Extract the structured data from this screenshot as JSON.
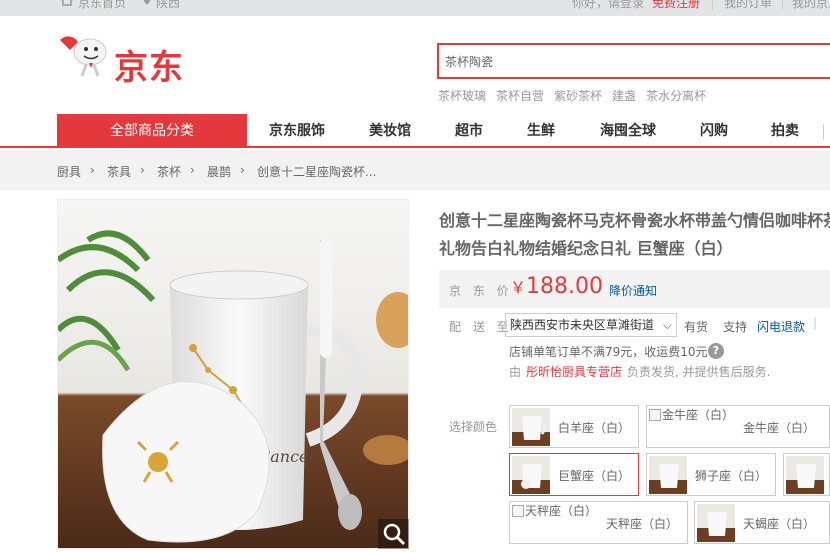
{
  "topbar": {
    "home": "京东首页",
    "location": "陕西",
    "greeting": "你好，请登录",
    "register": "免费注册",
    "orders": "我的订单",
    "my_jd": "我的京东"
  },
  "logo": {
    "text": "京东"
  },
  "search": {
    "value": "茶杯陶瓷"
  },
  "hotwords": [
    "茶杯玻璃",
    "茶杯自营",
    "紫砂茶杯",
    "建盏",
    "茶水分离杯"
  ],
  "nav": {
    "all_categories": "全部商品分类",
    "items": [
      "京东服饰",
      "美妆馆",
      "超市",
      "生鲜",
      "海囤全球",
      "闪购",
      "拍卖"
    ]
  },
  "breadcrumb": [
    "厨具",
    "茶具",
    "茶杯",
    "晨鹊",
    "创意十二星座陶瓷杯..."
  ],
  "product": {
    "title_line1": "创意十二星座陶瓷杯马克杯骨瓷水杯带盖勺情侣咖啡杯茶",
    "title_line2": "礼物告白礼物结婚纪念日礼 巨蟹座（白）",
    "price_label": "京 东 价",
    "currency": "￥",
    "price": "188.00",
    "price_notice": "降价通知"
  },
  "delivery": {
    "label": "配 送 至",
    "address": "陕西西安市未央区草滩街道",
    "stock": "有货",
    "support": "支持",
    "return_link": "闪电退款",
    "shipping_note": "店铺单笔订单不满79元，收运费10元",
    "from": "由",
    "seller": "彤昕怡厨具专营店",
    "seller_note": "负责发货, 并提供售后服务."
  },
  "colors": {
    "label": "选择颜色",
    "options": [
      {
        "name": "白羊座（白）",
        "alt": ""
      },
      {
        "name": "金牛座（白）",
        "alt": "金牛座（白）"
      },
      {
        "name": "巨蟹座（白）",
        "alt": ""
      },
      {
        "name": "狮子座（白）",
        "alt": ""
      },
      {
        "name": "天秤座（白）",
        "alt": "天秤座（白）"
      },
      {
        "name": "天蝎座（白）",
        "alt": ""
      }
    ]
  },
  "accent": "#e4393c",
  "link_color": "#005aa0"
}
